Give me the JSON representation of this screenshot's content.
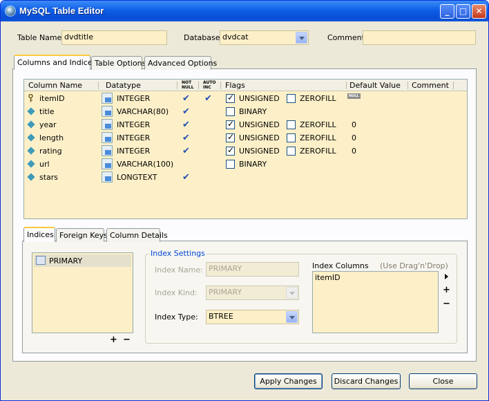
{
  "window": {
    "title": "MySQL Table Editor",
    "controls": [
      "_",
      "□",
      "✕"
    ]
  },
  "header": {
    "table_name_label": "Table Name:",
    "table_name": "dvdtitle",
    "database_label": "Database:",
    "database": "dvdcat",
    "comment_label": "Comment:",
    "comment": ""
  },
  "tabs": [
    "Columns and Indices",
    "Table Options",
    "Advanced Options"
  ],
  "grid": {
    "headers": {
      "column_name": "Column Name",
      "datatype": "Datatype",
      "not_null": [
        "NOT",
        "NULL"
      ],
      "auto_inc": [
        "AUTO",
        "INC"
      ],
      "flags": "Flags",
      "default_value": "Default Value",
      "comment": "Comment"
    },
    "rows": [
      {
        "name": "itemID",
        "type": "INTEGER",
        "pk": true,
        "not_null": true,
        "auto_inc": true,
        "flag1": "UNSIGNED",
        "flag1_on": true,
        "flag2": "ZEROFILL",
        "flag2_on": false,
        "default": "NULL"
      },
      {
        "name": "title",
        "type": "VARCHAR(80)",
        "pk": false,
        "not_null": true,
        "auto_inc": false,
        "flag1": "BINARY",
        "flag1_on": false,
        "flag2": "",
        "flag2_on": false,
        "default": ""
      },
      {
        "name": "year",
        "type": "INTEGER",
        "pk": false,
        "not_null": true,
        "auto_inc": false,
        "flag1": "UNSIGNED",
        "flag1_on": true,
        "flag2": "ZEROFILL",
        "flag2_on": false,
        "default": "0"
      },
      {
        "name": "length",
        "type": "INTEGER",
        "pk": false,
        "not_null": true,
        "auto_inc": false,
        "flag1": "UNSIGNED",
        "flag1_on": true,
        "flag2": "ZEROFILL",
        "flag2_on": false,
        "default": "0"
      },
      {
        "name": "rating",
        "type": "INTEGER",
        "pk": false,
        "not_null": true,
        "auto_inc": false,
        "flag1": "UNSIGNED",
        "flag1_on": true,
        "flag2": "ZEROFILL",
        "flag2_on": false,
        "default": "0"
      },
      {
        "name": "url",
        "type": "VARCHAR(100)",
        "pk": false,
        "not_null": false,
        "auto_inc": false,
        "flag1": "BINARY",
        "flag1_on": false,
        "flag2": "",
        "flag2_on": false,
        "default": ""
      },
      {
        "name": "stars",
        "type": "LONGTEXT",
        "pk": false,
        "not_null": true,
        "auto_inc": false,
        "flag1": "",
        "flag1_on": false,
        "flag2": "",
        "flag2_on": false,
        "default": ""
      }
    ]
  },
  "subtabs": [
    "Indices",
    "Foreign Keys",
    "Column Details"
  ],
  "indices": {
    "list": [
      "PRIMARY"
    ],
    "add": "+",
    "remove": "−",
    "settings_title": "Index Settings",
    "index_name_label": "Index Name:",
    "index_name": "PRIMARY",
    "index_kind_label": "Index Kind:",
    "index_kind": "PRIMARY",
    "index_type_label": "Index Type:",
    "index_type": "BTREE",
    "columns_label": "Index Columns",
    "columns_hint": "(Use Drag'n'Drop)",
    "columns": [
      "itemID"
    ],
    "col_add": "+",
    "col_remove": "−"
  },
  "buttons": {
    "apply": "Apply Changes",
    "discard": "Discard Changes",
    "close": "Close"
  }
}
